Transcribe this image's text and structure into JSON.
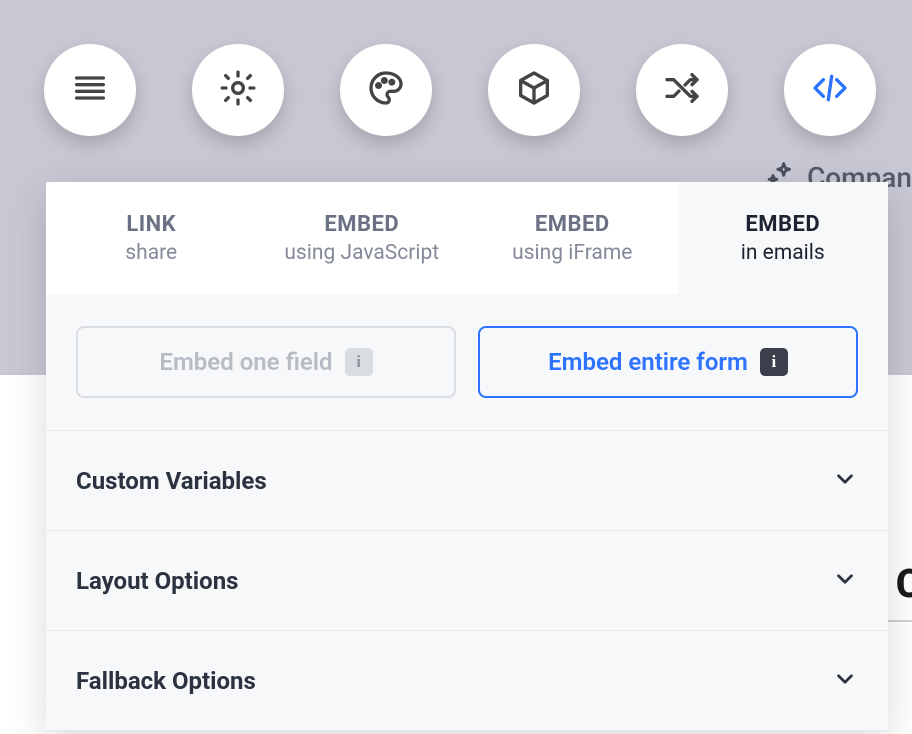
{
  "topIcons": [
    "menu",
    "settings",
    "palette",
    "cube",
    "shuffle",
    "code"
  ],
  "topExtra": {
    "label": "Compan"
  },
  "tabs": [
    {
      "title": "LINK",
      "sub": "share",
      "active": false
    },
    {
      "title": "EMBED",
      "sub": "using JavaScript",
      "active": false
    },
    {
      "title": "EMBED",
      "sub": "using iFrame",
      "active": false
    },
    {
      "title": "EMBED",
      "sub": "in emails",
      "active": true
    }
  ],
  "options": {
    "one_field": "Embed one field",
    "entire_form": "Embed entire form"
  },
  "accordion": [
    {
      "label": "Custom Variables"
    },
    {
      "label": "Layout Options"
    },
    {
      "label": "Fallback Options"
    }
  ],
  "info_char": "i",
  "side_letter": "C"
}
